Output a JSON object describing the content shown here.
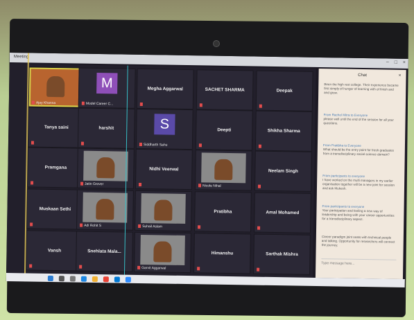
{
  "window": {
    "title": "Meeting"
  },
  "chat": {
    "title": "Chat",
    "messages": [
      {
        "from": "",
        "text": "Been the high rest college. Their experience became first simply of hunger of learning with of finish and and grow."
      },
      {
        "from": "From Rachel Mitra to Everyone",
        "text": "please well until the end of the session for all your questions."
      },
      {
        "from": "From Pratibha to Everyone",
        "text": "What should be the entry point for fresh graduates from a transdisciplinary social science domain?"
      },
      {
        "from": "From participants to everyone",
        "text": "I have worked on the multi managers in my earlier organisation together will be a new joint for session and ask Mukesh."
      },
      {
        "from": "From participants to everyone",
        "text": "Your participation and feeling a new way of leadership and being with your career opportunities for a transdisciplinary aspect."
      },
      {
        "from": "",
        "text": "Career paradigm joint seats with technical people and talking. Opportunity for researchers will connect the journey."
      }
    ],
    "input_placeholder": "Type message here..."
  },
  "tiles": [
    {
      "id": "p1",
      "name": "",
      "label": "Ajay Khanna",
      "type": "video",
      "active": true
    },
    {
      "id": "p2",
      "name": "",
      "label": "Model Career C...",
      "type": "avatar",
      "initial": "M",
      "color": "#8e4fb8"
    },
    {
      "id": "p3",
      "name": "Megha Aggarwal",
      "label": "",
      "type": "name"
    },
    {
      "id": "p4",
      "name": "SACHET SHARMA",
      "label": "",
      "type": "name"
    },
    {
      "id": "p5",
      "name": "Deepak",
      "label": "",
      "type": "name"
    },
    {
      "id": "p6",
      "name": "Tanya saini",
      "label": "",
      "type": "name"
    },
    {
      "id": "p7",
      "name": "harshit",
      "label": "",
      "type": "name"
    },
    {
      "id": "p8",
      "name": "",
      "label": "Siddharth Sahu",
      "type": "avatar",
      "initial": "S",
      "color": "#5a4aa8"
    },
    {
      "id": "p9",
      "name": "Deepti",
      "label": "",
      "type": "name"
    },
    {
      "id": "p10",
      "name": "Shikha Sharma",
      "label": "",
      "type": "name"
    },
    {
      "id": "p11",
      "name": "Pramgana",
      "label": "",
      "type": "name"
    },
    {
      "id": "p12",
      "name": "",
      "label": "Jatin Grover",
      "type": "video"
    },
    {
      "id": "p13",
      "name": "Nidhi Veerwal",
      "label": "",
      "type": "name"
    },
    {
      "id": "p14",
      "name": "",
      "label": "Nicole Nihal",
      "type": "video"
    },
    {
      "id": "p15",
      "name": "Neelam Singh",
      "label": "",
      "type": "name"
    },
    {
      "id": "p16",
      "name": "Muskaan Sethi",
      "label": "",
      "type": "name"
    },
    {
      "id": "p17",
      "name": "",
      "label": "Adi Rohit S",
      "type": "video"
    },
    {
      "id": "p18",
      "name": "",
      "label": "Suhail Aslam",
      "type": "video"
    },
    {
      "id": "p19",
      "name": "Pratibha",
      "label": "",
      "type": "name"
    },
    {
      "id": "p20",
      "name": "Amal Mohamed",
      "label": "",
      "type": "name"
    },
    {
      "id": "p21",
      "name": "Vansh",
      "label": "",
      "type": "name"
    },
    {
      "id": "p22",
      "name": "Snehlata Mala...",
      "label": "",
      "type": "name"
    },
    {
      "id": "p23",
      "name": "",
      "label": "Garvit Aggarwal",
      "type": "video"
    },
    {
      "id": "p24",
      "name": "Himanshu",
      "label": "",
      "type": "name"
    },
    {
      "id": "p25",
      "name": "Sarthak Mishra",
      "label": "",
      "type": "name"
    }
  ],
  "colors": {
    "active_border": "#d8d34a",
    "mic_muted": "#e24d4d",
    "divider": "#37c0c8"
  },
  "taskbar_icons": [
    "start-icon",
    "search-icon",
    "task-view-icon",
    "edge-icon",
    "explorer-icon",
    "chrome-icon",
    "store-icon",
    "zoom-icon"
  ]
}
